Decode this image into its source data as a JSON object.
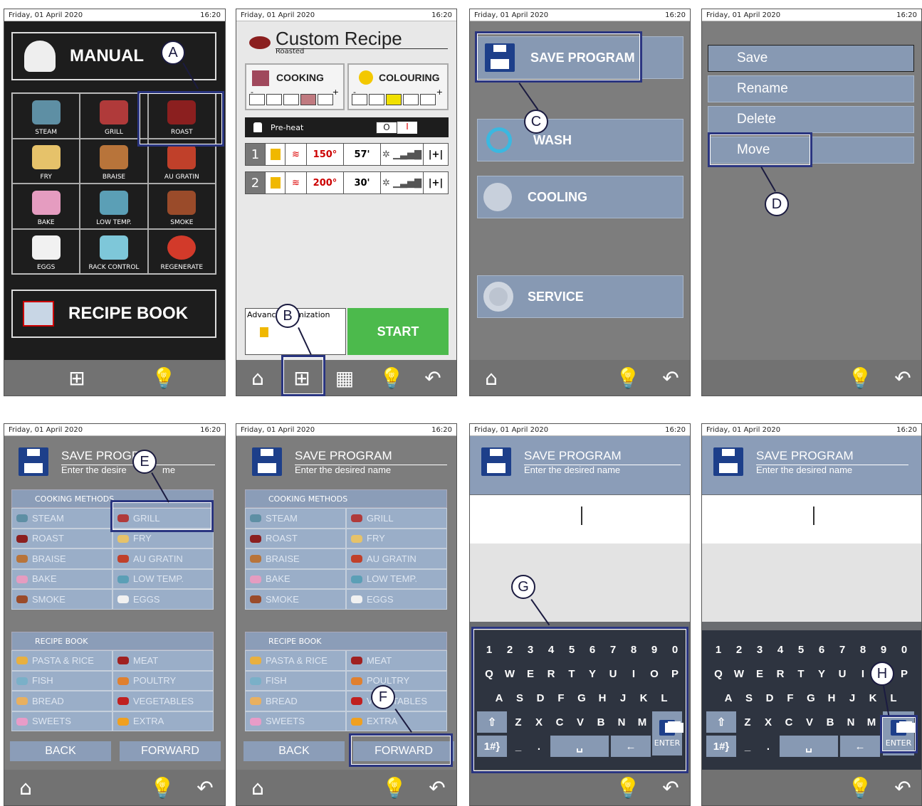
{
  "status": {
    "date": "Friday, 01 April 2020",
    "time": "16:20"
  },
  "panel1": {
    "manual": "MANUAL",
    "modes": [
      "STEAM",
      "GRILL",
      "ROAST",
      "FRY",
      "BRAISE",
      "AU GRATIN",
      "BAKE",
      "LOW TEMP.",
      "SMOKE",
      "EGGS",
      "RACK CONTROL",
      "REGENERATE"
    ],
    "recipe_book": "RECIPE BOOK",
    "callout": "A"
  },
  "panel2": {
    "title": "Custom Recipe",
    "subtitle": "Roasted",
    "cooking": "COOKING",
    "colouring": "COLOURING",
    "minus": "-",
    "plus": "+",
    "preheat": "Pre-heat",
    "toggle_off": "O",
    "toggle_on": "I",
    "phases": [
      {
        "num": "1",
        "temp": "150°",
        "time": "57'"
      },
      {
        "num": "2",
        "temp": "200°",
        "time": "30'"
      }
    ],
    "advanced": "Advanc     tomization",
    "start": "START",
    "callout": "B"
  },
  "panel3": {
    "save_program": "SAVE PROGRAM",
    "wash": "WASH",
    "cooling": "COOLING",
    "service": "SERVICE",
    "callout": "C"
  },
  "panel4": {
    "items": [
      "Save",
      "Rename",
      "Delete",
      "Move"
    ],
    "callout": "D"
  },
  "save": {
    "title": "SAVE PROGRAM",
    "subtitle": "Enter the desired name",
    "cooking_methods": "COOKING METHODS",
    "methods": [
      [
        "STEAM",
        "GRILL"
      ],
      [
        "ROAST",
        "FRY"
      ],
      [
        "BRAISE",
        "AU GRATIN"
      ],
      [
        "BAKE",
        "LOW TEMP."
      ],
      [
        "SMOKE",
        "EGGS"
      ]
    ],
    "recipe_book": "RECIPE BOOK",
    "books": [
      [
        "PASTA & RICE",
        "MEAT"
      ],
      [
        "FISH",
        "POULTRY"
      ],
      [
        "BREAD",
        "VEGETABLES"
      ],
      [
        "SWEETS",
        "EXTRA"
      ]
    ],
    "back": "BACK",
    "forward": "FORWARD"
  },
  "panel5": {
    "title_partial": "SAVE PROGR",
    "subtitle_partial": "Enter the desire",
    "subtitle_end": "me",
    "callout": "E"
  },
  "panel6": {
    "callout": "F"
  },
  "keyboard": {
    "row1": [
      "1",
      "2",
      "3",
      "4",
      "5",
      "6",
      "7",
      "8",
      "9",
      "0"
    ],
    "row2": [
      "Q",
      "W",
      "E",
      "R",
      "T",
      "Y",
      "U",
      "I",
      "O",
      "P"
    ],
    "row3": [
      "A",
      "S",
      "D",
      "F",
      "G",
      "H",
      "J",
      "K",
      "L"
    ],
    "row4": [
      "Z",
      "X",
      "C",
      "V",
      "B",
      "N",
      "M"
    ],
    "sym": "1#}",
    "enter": "ENTER"
  },
  "panel7": {
    "callout": "G"
  },
  "panel8": {
    "callout": "H"
  }
}
